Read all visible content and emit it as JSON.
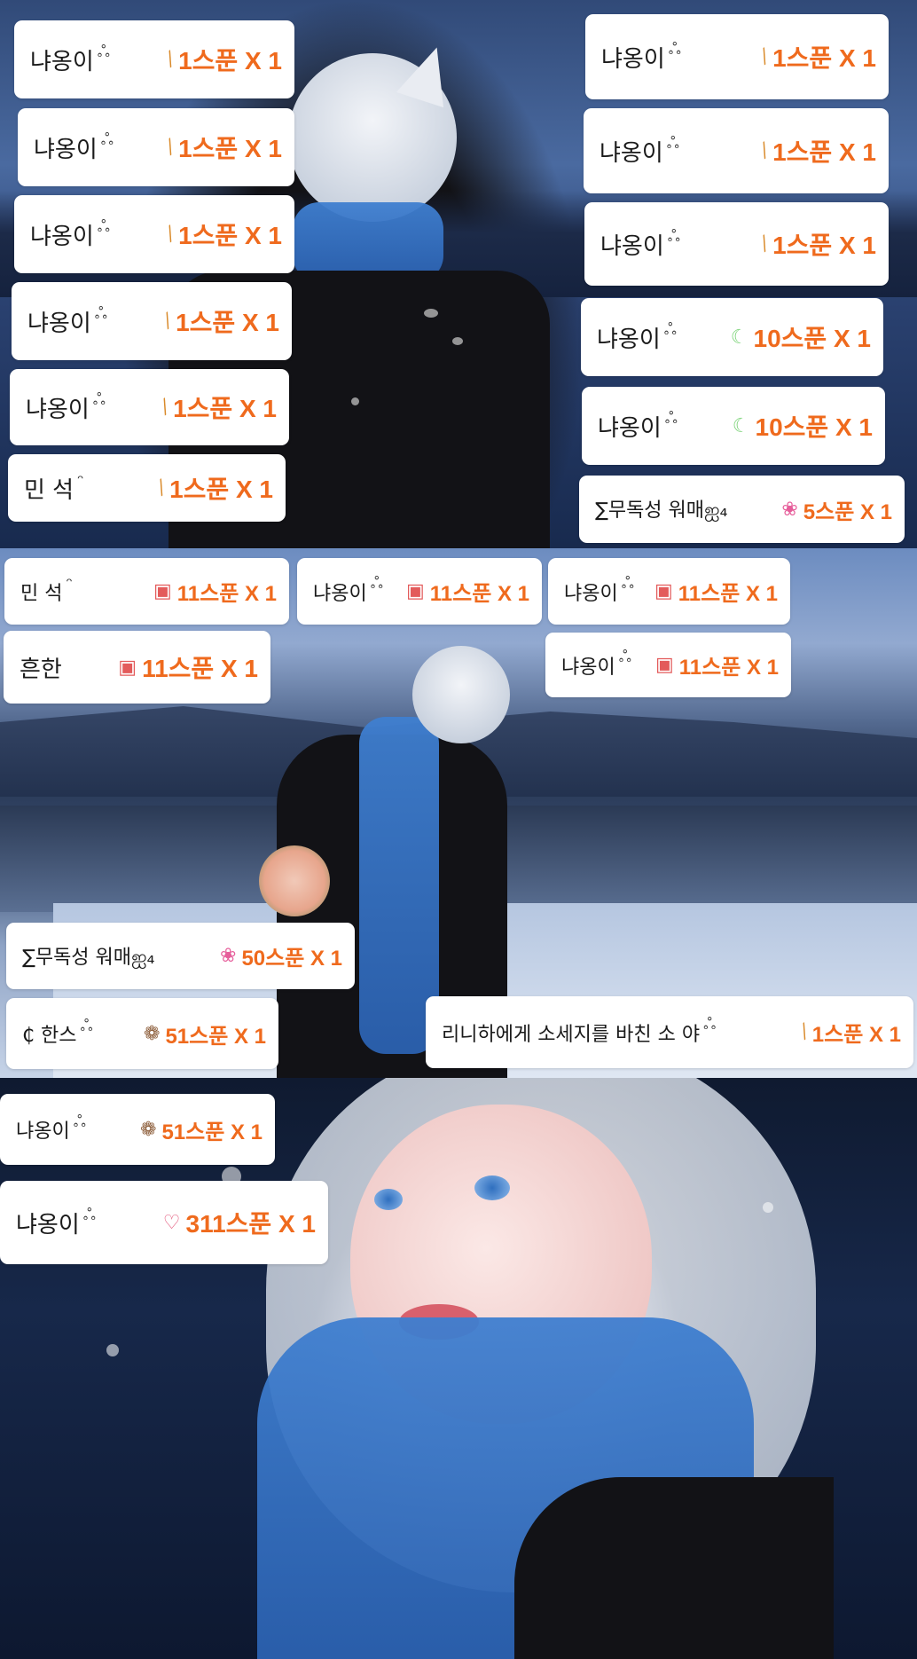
{
  "cards": [
    {
      "name": "냐옹이",
      "mark": "ஃ",
      "gift": "1스푼 X 1",
      "icon": "churro-icon"
    },
    {
      "name": "냐옹이",
      "mark": "ஃ",
      "gift": "1스푼 X 1",
      "icon": "churro-icon"
    },
    {
      "name": "냐옹이",
      "mark": "ஃ",
      "gift": "1스푼 X 1",
      "icon": "churro-icon"
    },
    {
      "name": "냐옹이",
      "mark": "ஃ",
      "gift": "1스푼 X 1",
      "icon": "churro-icon"
    },
    {
      "name": "냐옹이",
      "mark": "ஃ",
      "gift": "1스푼 X 1",
      "icon": "churro-icon"
    },
    {
      "name": "민 석",
      "mark": "ᵔ",
      "gift": "1스푼 X 1",
      "icon": "churro-icon"
    },
    {
      "name": "냐옹이",
      "mark": "ஃ",
      "gift": "1스푼 X 1",
      "icon": "churro-icon"
    },
    {
      "name": "냐옹이",
      "mark": "ஃ",
      "gift": "1스푼 X 1",
      "icon": "churro-icon"
    },
    {
      "name": "냐옹이",
      "mark": "ஃ",
      "gift": "1스푼 X 1",
      "icon": "churro-icon"
    },
    {
      "name": "냐옹이",
      "mark": "ஃ",
      "gift": "10스푼 X 1",
      "icon": "moon-icon"
    },
    {
      "name": "냐옹이",
      "mark": "ஃ",
      "gift": "10스푼 X 1",
      "icon": "moon-icon"
    },
    {
      "name": "∑무독성 워매ஐ₄",
      "mark": "",
      "gift": "5스푼 X 1",
      "icon": "flower-icon"
    },
    {
      "name": "민 석",
      "mark": "ᵔ",
      "gift": "11스푼 X 1",
      "icon": "cake-icon"
    },
    {
      "name": "냐옹이",
      "mark": "ஃ",
      "gift": "11스푼 X 1",
      "icon": "cake-icon"
    },
    {
      "name": "냐옹이",
      "mark": "ஃ",
      "gift": "11스푼 X 1",
      "icon": "cake-icon"
    },
    {
      "name": "흔한",
      "mark": "",
      "gift": "11스푼 X 1",
      "icon": "cake-icon"
    },
    {
      "name": "냐옹이",
      "mark": "ஃ",
      "gift": "11스푼 X 1",
      "icon": "cake-icon"
    },
    {
      "name": "∑무독성 워매ஐ₄",
      "mark": "",
      "gift": "50스푼 X 1",
      "icon": "flower-icon"
    },
    {
      "name": "₵ 한스",
      "mark": "ஃ",
      "gift": "51스푼 X 1",
      "icon": "bear-icon"
    },
    {
      "name": "리니하에게 소세지를 바친 소 야",
      "mark": "ஃ",
      "gift": "1스푼 X 1",
      "icon": "churro-icon"
    },
    {
      "name": "냐옹이",
      "mark": "ஃ",
      "gift": "51스푼 X 1",
      "icon": "bear-icon"
    },
    {
      "name": "냐옹이",
      "mark": "ஃ",
      "gift": "311스푼 X 1",
      "icon": "heart-icon"
    }
  ],
  "icons": {
    "churro-icon": "⁄",
    "moon-icon": "☾",
    "flower-icon": "❀",
    "cake-icon": "▣",
    "bear-icon": "❁",
    "heart-icon": "♡"
  },
  "colors": {
    "gift_text": "#ef6a1d",
    "card_bg": "#ffffff",
    "name_text": "#1a1a1a"
  }
}
